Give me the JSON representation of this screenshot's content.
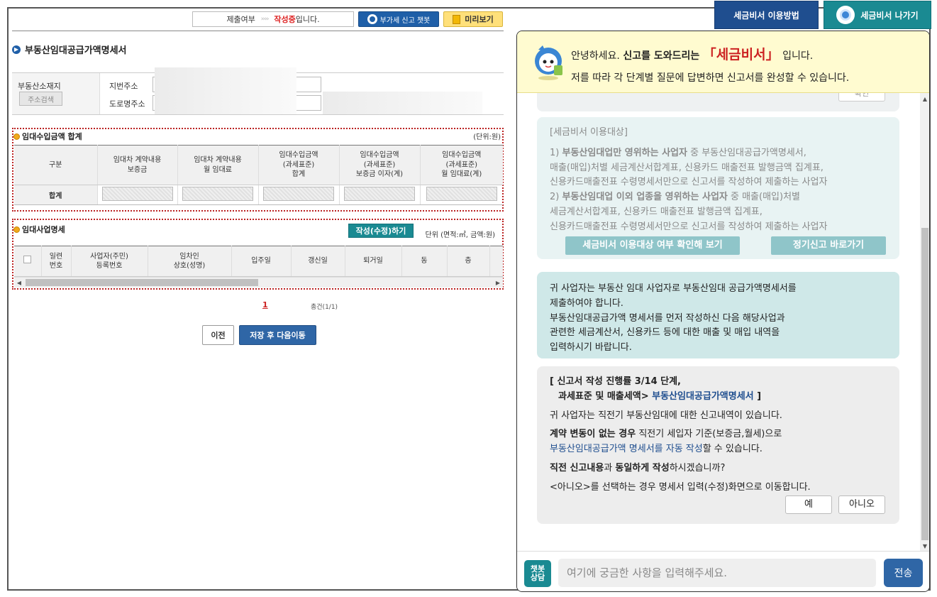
{
  "topbar": {
    "submit_label": "제출여부",
    "arrows": "››››",
    "state_text": "작성중",
    "state_suffix": "입니다.",
    "chatbot_btn": "부가세 신고 챗봇",
    "preview_btn": "미리보기",
    "howto_btn": "세금비서 이용방법",
    "exit_btn": "세금비서 나가기"
  },
  "form": {
    "title": "부동산임대공급가액명세서",
    "address": {
      "label": "부동산소재지",
      "search_btn": "주소검색",
      "lot_label": "지번주소",
      "road_label": "도로명주소"
    },
    "summary": {
      "title": "임대수입금액 합계",
      "unit": "(단위:원)",
      "headers": [
        "구분",
        "임대차 계약내용\n보증금",
        "임대차 계약내용\n월 임대료",
        "임대수입금액\n(과세표준)\n합계",
        "임대수입금액\n(과세표준)\n보증금 이자(계)",
        "임대수입금액\n(과세표준)\n월 임대료(계)"
      ],
      "row_label": "합계"
    },
    "detail": {
      "title": "임대사업명세",
      "write_btn": "작성(수정)하기",
      "unit": "단위 (면적:㎡, 금액:원)",
      "headers": [
        "일련\n번호",
        "사업자(주민)\n등록번호",
        "임차인\n상호(성명)",
        "입주일",
        "갱신일",
        "퇴거일",
        "동",
        "층"
      ]
    },
    "pagination": {
      "page": "1",
      "total": "총건(1/1)"
    },
    "prev_btn": "이전",
    "save_next_btn": "저장 후 다음이동"
  },
  "chat": {
    "banner": {
      "greet": "안녕하세요. ",
      "greet_b": "신고를 도와드리는",
      "brand": "「세금비서」",
      "greet_end": "입니다.",
      "line2": "저를 따라 각 단계별 질문에 답변하면 신고서를 완성할 수 있습니다."
    },
    "top_btn": "확인",
    "target": {
      "title": "[세금비서 이용대상]",
      "p1_a": "1) ",
      "p1_b": "부동산임대업만 영위하는 사업자",
      "p1_c": " 중 부동산임대공급가액명세서,",
      "p1_d": "매출(매입)처별 세금계산서합계표, 신용카드 매출전표 발행금액 집계표,",
      "p1_e": "신용카드매출전표 수령명세서만으로 신고서를 작성하여 제출하는 사업자",
      "p2_a": "2) ",
      "p2_b": "부동산임대업 이외 업종을 영위하는 사업자",
      "p2_c": " 중 매출(매입)처별",
      "p2_d": "세금계산서합계표, 신용카드 매출전표 발행금액 집계표,",
      "p2_e": "신용카드매출전표 수령명세서만으로 신고서를 작성하여 제출하는 사업자",
      "btn_check": "세금비서 이용대상 여부 확인해 보기",
      "btn_regular": "정기신고 바로가기"
    },
    "info": {
      "l1": "귀 사업자는 부동산 임대 사업자로 부동산임대 공급가액명세서를",
      "l2": "제출하여야 합니다.",
      "l3": "부동산임대공급가액 명세서를 먼저 작성하신 다음 해당사업과",
      "l4": "관련한 세금계산서, 신용카드 등에 대한 매출 및 매입 내역을",
      "l5": "입력하시기 바랍니다."
    },
    "progress": {
      "h1": "[ 신고서 작성 진행률 3/14 단계,",
      "h2a": "과세표준 및 매출세액> ",
      "h2b": "부동산임대공급가액명세서",
      "h2c": " ]",
      "p1": "귀 사업자는 직전기 부동산임대에 대한 신고내역이 있습니다.",
      "p2a": "계약 변동이 없는 경우",
      "p2b": " 직전기 세입자 기준(보증금,월세)으로",
      "p2c": "부동산임대공급가액 명세서를 자동 작성",
      "p2d": "할 수 있습니다.",
      "p3a": "직전 신고내용",
      "p3b": "과 ",
      "p3c": "동일하게 작성",
      "p3d": "하시겠습니까?",
      "p4": "<아니오>를 선택하는 경우 명세서 입력(수정)화면으로 이동합니다.",
      "yes": "예",
      "no": "아니오"
    },
    "footer": {
      "consult": "챗봇\n상담",
      "placeholder": "여기에 궁금한 사항을 입력해주세요.",
      "send": "전송"
    }
  },
  "colors": {
    "teal": "#1a8a92",
    "navy": "#1f4e8f",
    "red_state": "#dd2222",
    "banner_bg": "#fffbd0"
  }
}
